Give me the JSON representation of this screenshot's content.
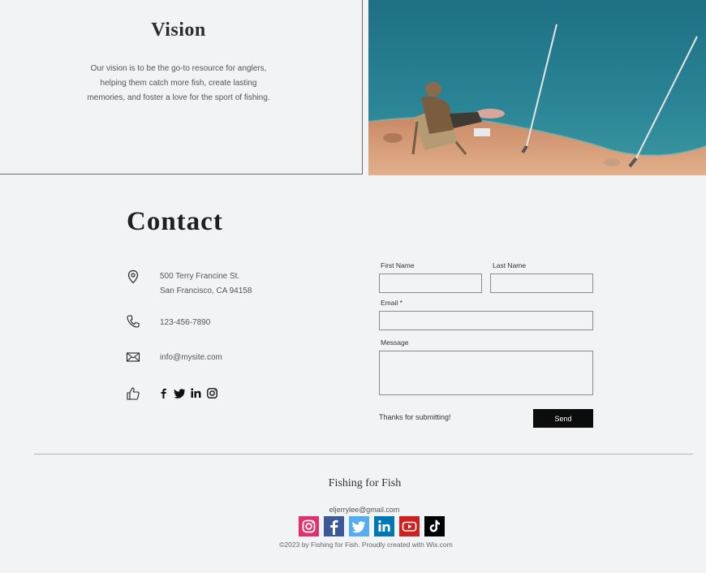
{
  "vision": {
    "title": "Vision",
    "line1": "Our vision is to be the go-to resource for anglers,",
    "line2": "helping them catch more fish, create lasting",
    "line3": "memories, and foster a love for the sport of fishing."
  },
  "contact": {
    "title": "Contact",
    "address_line1": "500 Terry Francine St.",
    "address_line2": "San Francisco, CA 94158",
    "phone": "123-456-7890",
    "email": "info@mysite.com",
    "social_icons": [
      "facebook-icon",
      "twitter-icon",
      "linkedin-icon",
      "instagram-icon"
    ]
  },
  "form": {
    "first_name_label": "First Name",
    "last_name_label": "Last Name",
    "email_label": "Email *",
    "message_label": "Message",
    "first_name_value": "",
    "last_name_value": "",
    "email_value": "",
    "message_value": "",
    "thanks_text": "Thanks for submitting!",
    "send_label": "Send"
  },
  "footer": {
    "brand": "Fishing for Fish",
    "email": "eljerrylee@gmail.com",
    "icons": [
      "instagram-icon",
      "facebook-icon",
      "twitter-icon",
      "linkedin-icon",
      "youtube-icon",
      "tiktok-icon"
    ],
    "copyright": "©2023 by Fishing for Fish. Proudly created with Wix.com"
  },
  "colors": {
    "background": "#f2f3f5",
    "send_button": "#0c0c0c",
    "instagram": "#e1306c",
    "facebook": "#3b5998",
    "twitter": "#55acee",
    "linkedin": "#0077b5",
    "youtube": "#cd201f",
    "tiktok": "#010101"
  }
}
